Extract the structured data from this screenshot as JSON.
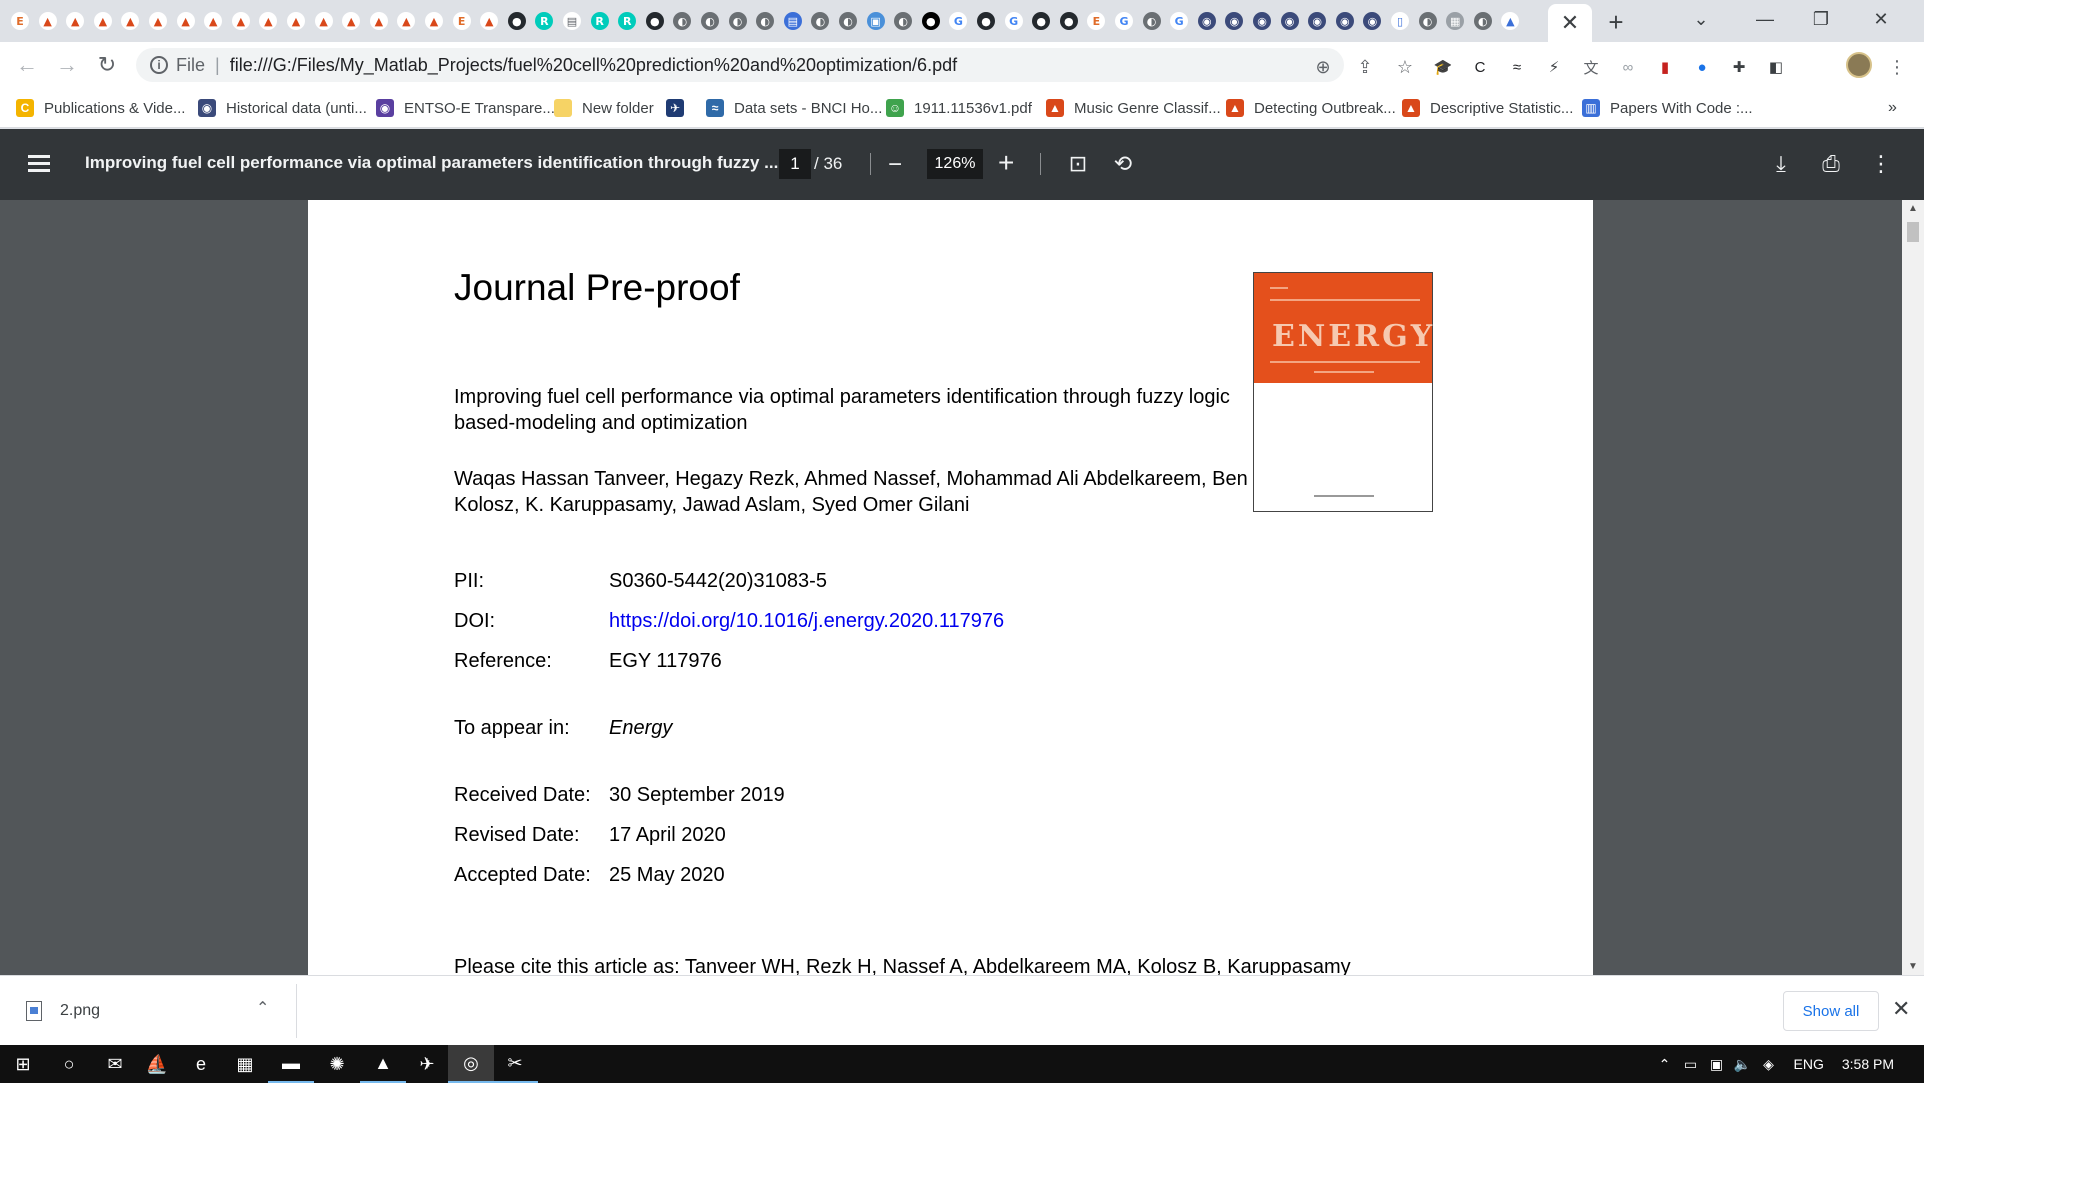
{
  "browser": {
    "mini_tabs": [
      {
        "icon": "ieee-e-icon",
        "glyph": "E",
        "bg": "#ffffff",
        "fg": "#e06c2a"
      },
      {
        "icon": "matlab-icon",
        "glyph": "▲",
        "bg": "#ffffff",
        "fg": "#d9481a"
      },
      {
        "icon": "matlab-icon",
        "glyph": "▲",
        "bg": "#ffffff",
        "fg": "#d9481a"
      },
      {
        "icon": "matlab-icon",
        "glyph": "▲",
        "bg": "#ffffff",
        "fg": "#d9481a"
      },
      {
        "icon": "matlab-icon",
        "glyph": "▲",
        "bg": "#ffffff",
        "fg": "#d9481a"
      },
      {
        "icon": "matlab-icon",
        "glyph": "▲",
        "bg": "#ffffff",
        "fg": "#d9481a"
      },
      {
        "icon": "matlab-icon",
        "glyph": "▲",
        "bg": "#ffffff",
        "fg": "#d9481a"
      },
      {
        "icon": "matlab-icon",
        "glyph": "▲",
        "bg": "#ffffff",
        "fg": "#d9481a"
      },
      {
        "icon": "matlab-icon",
        "glyph": "▲",
        "bg": "#ffffff",
        "fg": "#d9481a"
      },
      {
        "icon": "matlab-icon",
        "glyph": "▲",
        "bg": "#ffffff",
        "fg": "#d9481a"
      },
      {
        "icon": "matlab-icon",
        "glyph": "▲",
        "bg": "#ffffff",
        "fg": "#d9481a"
      },
      {
        "icon": "matlab-icon",
        "glyph": "▲",
        "bg": "#ffffff",
        "fg": "#d9481a"
      },
      {
        "icon": "matlab-icon",
        "glyph": "▲",
        "bg": "#ffffff",
        "fg": "#d9481a"
      },
      {
        "icon": "matlab-icon",
        "glyph": "▲",
        "bg": "#ffffff",
        "fg": "#d9481a"
      },
      {
        "icon": "matlab-icon",
        "glyph": "▲",
        "bg": "#ffffff",
        "fg": "#d9481a"
      },
      {
        "icon": "matlab-icon",
        "glyph": "▲",
        "bg": "#ffffff",
        "fg": "#d9481a"
      },
      {
        "icon": "ieee-e-icon",
        "glyph": "E",
        "bg": "#ffffff",
        "fg": "#e06c2a"
      },
      {
        "icon": "matlab-icon",
        "glyph": "▲",
        "bg": "#ffffff",
        "fg": "#d9481a"
      },
      {
        "icon": "github-icon",
        "glyph": "●",
        "bg": "#24292e",
        "fg": "#ffffff"
      },
      {
        "icon": "researchgate-icon",
        "glyph": "R",
        "bg": "#00ccbb",
        "fg": "#ffffff"
      },
      {
        "icon": "pdf-icon",
        "glyph": "▤",
        "bg": "#ffffff",
        "fg": "#5f6368"
      },
      {
        "icon": "researchgate-icon",
        "glyph": "R",
        "bg": "#00ccbb",
        "fg": "#ffffff"
      },
      {
        "icon": "researchgate-icon",
        "glyph": "R",
        "bg": "#00ccbb",
        "fg": "#ffffff"
      },
      {
        "icon": "github-icon",
        "glyph": "●",
        "bg": "#24292e",
        "fg": "#ffffff"
      },
      {
        "icon": "globe-icon",
        "glyph": "◐",
        "bg": "#6a6f73",
        "fg": "#ffffff"
      },
      {
        "icon": "globe-icon",
        "glyph": "◐",
        "bg": "#6a6f73",
        "fg": "#ffffff"
      },
      {
        "icon": "globe-icon",
        "glyph": "◐",
        "bg": "#6a6f73",
        "fg": "#ffffff"
      },
      {
        "icon": "globe-icon",
        "glyph": "◐",
        "bg": "#6a6f73",
        "fg": "#ffffff"
      },
      {
        "icon": "pdf-icon",
        "glyph": "▤",
        "bg": "#3b6fd8",
        "fg": "#ffffff"
      },
      {
        "icon": "globe-icon",
        "glyph": "◐",
        "bg": "#6a6f73",
        "fg": "#ffffff"
      },
      {
        "icon": "globe-icon",
        "glyph": "◐",
        "bg": "#6a6f73",
        "fg": "#ffffff"
      },
      {
        "icon": "image-icon",
        "glyph": "▣",
        "bg": "#4a90d9",
        "fg": "#ffffff"
      },
      {
        "icon": "globe-icon",
        "glyph": "◐",
        "bg": "#6a6f73",
        "fg": "#ffffff"
      },
      {
        "icon": "medium-icon",
        "glyph": "●",
        "bg": "#000000",
        "fg": "#ffffff"
      },
      {
        "icon": "google-icon",
        "glyph": "G",
        "bg": "#ffffff",
        "fg": "#4285f4"
      },
      {
        "icon": "github-icon",
        "glyph": "●",
        "bg": "#24292e",
        "fg": "#ffffff"
      },
      {
        "icon": "google-icon",
        "glyph": "G",
        "bg": "#ffffff",
        "fg": "#4285f4"
      },
      {
        "icon": "github-icon",
        "glyph": "●",
        "bg": "#24292e",
        "fg": "#ffffff"
      },
      {
        "icon": "github-icon",
        "glyph": "●",
        "bg": "#24292e",
        "fg": "#ffffff"
      },
      {
        "icon": "ieee-e-icon",
        "glyph": "E",
        "bg": "#ffffff",
        "fg": "#e06c2a"
      },
      {
        "icon": "google-icon",
        "glyph": "G",
        "bg": "#ffffff",
        "fg": "#4285f4"
      },
      {
        "icon": "globe-icon",
        "glyph": "◐",
        "bg": "#6a6f73",
        "fg": "#ffffff"
      },
      {
        "icon": "google-icon",
        "glyph": "G",
        "bg": "#ffffff",
        "fg": "#4285f4"
      },
      {
        "icon": "globe-icon",
        "glyph": "◉",
        "bg": "#3b4a7a",
        "fg": "#ffffff"
      },
      {
        "icon": "globe-icon",
        "glyph": "◉",
        "bg": "#3b4a7a",
        "fg": "#ffffff"
      },
      {
        "icon": "globe-icon",
        "glyph": "◉",
        "bg": "#3b4a7a",
        "fg": "#ffffff"
      },
      {
        "icon": "globe-icon",
        "glyph": "◉",
        "bg": "#3b4a7a",
        "fg": "#ffffff"
      },
      {
        "icon": "globe-icon",
        "glyph": "◉",
        "bg": "#3b4a7a",
        "fg": "#ffffff"
      },
      {
        "icon": "globe-icon",
        "glyph": "◉",
        "bg": "#3b4a7a",
        "fg": "#ffffff"
      },
      {
        "icon": "globe-icon",
        "glyph": "◉",
        "bg": "#3b4a7a",
        "fg": "#ffffff"
      },
      {
        "icon": "doc-icon",
        "glyph": "▯",
        "bg": "#ffffff",
        "fg": "#3b6fd8"
      },
      {
        "icon": "globe-icon",
        "glyph": "◐",
        "bg": "#6a6f73",
        "fg": "#ffffff"
      },
      {
        "icon": "image-icon",
        "glyph": "▦",
        "bg": "#9aa0a6",
        "fg": "#ffffff"
      },
      {
        "icon": "globe-icon",
        "glyph": "◐",
        "bg": "#6a6f73",
        "fg": "#ffffff"
      },
      {
        "icon": "matlab-icon",
        "glyph": "▲",
        "bg": "#ffffff",
        "fg": "#3b6fd8"
      }
    ],
    "active_tab_close": "✕",
    "new_tab": "+",
    "window_buttons": {
      "tab_search": "⌄",
      "minimize": "—",
      "restore": "❐",
      "close": "✕"
    },
    "nav": {
      "back": "←",
      "forward": "→",
      "reload": "↻"
    },
    "address": {
      "info_glyph": "i",
      "scheme_label": "File",
      "separator": "|",
      "url": "file:///G:/Files/My_Matlab_Projects/fuel%20cell%20prediction%20and%20optimization/6.pdf"
    },
    "omni_icons": {
      "zoom": "⊕",
      "share": "⇪",
      "star": "☆"
    },
    "extensions": [
      {
        "icon": "graduation-cap-icon",
        "glyph": "🎓",
        "color": "#1a73e8"
      },
      {
        "icon": "extension-c-icon",
        "glyph": "C",
        "color": "#202124"
      },
      {
        "icon": "extension-wave-icon",
        "glyph": "≈",
        "color": "#202124"
      },
      {
        "icon": "lightning-icon",
        "glyph": "⚡",
        "color": "#3c4043"
      },
      {
        "icon": "translate-icon",
        "glyph": "文",
        "color": "#5f6368"
      },
      {
        "icon": "link-icon",
        "glyph": "∞",
        "color": "#9aa0a6"
      },
      {
        "icon": "extension-red-icon",
        "glyph": "▮",
        "color": "#c5221f"
      },
      {
        "icon": "sphere-icon",
        "glyph": "●",
        "color": "#1a73e8"
      },
      {
        "icon": "puzzle-icon",
        "glyph": "✚",
        "color": "#3c4043"
      },
      {
        "icon": "sidepanel-icon",
        "glyph": "◧",
        "color": "#3c4043"
      }
    ],
    "menu_glyph": "⋮",
    "bookmarks": [
      {
        "label": "Publications & Vide...",
        "icon": "bookmark-c-icon",
        "glyph": "C",
        "bg": "#f4b400"
      },
      {
        "label": "Historical data (unti...",
        "icon": "bookmark-globe-icon",
        "glyph": "◉",
        "bg": "#3b4a7a"
      },
      {
        "label": "ENTSO-E Transpare...",
        "icon": "bookmark-entsoe-icon",
        "glyph": "◉",
        "bg": "#5a3fa0"
      },
      {
        "label": "New folder",
        "icon": "folder-icon",
        "glyph": "",
        "bg": "#f6d365"
      },
      {
        "label": "",
        "icon": "bookmark-bird-icon",
        "glyph": "✈",
        "bg": "#1f3b73"
      },
      {
        "label": "Data sets - BNCI Ho...",
        "icon": "bookmark-bnci-icon",
        "glyph": "≈",
        "bg": "#2f6aa8"
      },
      {
        "label": "1911.11536v1.pdf",
        "icon": "bookmark-smiley-icon",
        "glyph": "☺",
        "bg": "#3fa34d"
      },
      {
        "label": "Music Genre Classif...",
        "icon": "matlab-icon",
        "glyph": "▲",
        "bg": "#d9481a"
      },
      {
        "label": "Detecting Outbreak...",
        "icon": "matlab-icon",
        "glyph": "▲",
        "bg": "#d9481a"
      },
      {
        "label": "Descriptive Statistic...",
        "icon": "matlab-icon",
        "glyph": "▲",
        "bg": "#d9481a"
      },
      {
        "label": "Papers With Code :...",
        "icon": "paperswithcode-icon",
        "glyph": "▥",
        "bg": "#3b6fd8"
      }
    ],
    "bookmarks_more": "»"
  },
  "pdf": {
    "title": "Improving fuel cell performance via optimal parameters identification through fuzzy ...",
    "page_current": "1",
    "page_total": "/ 36",
    "zoom_out": "−",
    "zoom": "126%",
    "zoom_in": "+",
    "fit_glyph": "⊡",
    "rotate_glyph": "⟲",
    "download_glyph": "⤓",
    "print_glyph": "⎙",
    "more_glyph": "⋮",
    "scroll_up": "▲",
    "scroll_down": "▼"
  },
  "document": {
    "journal_label": "Journal Pre-proof",
    "title": "Improving fuel cell performance via optimal parameters identification through fuzzy logic based-modeling and optimization",
    "authors": "Waqas Hassan Tanveer, Hegazy Rezk, Ahmed Nassef, Mohammad Ali Abdelkareem, Ben Kolosz, K. Karuppasamy, Jawad Aslam, Syed Omer Gilani",
    "pii_label": "PII:",
    "pii_value": "S0360-5442(20)31083-5",
    "doi_label": "DOI:",
    "doi_value": "https://doi.org/10.1016/j.energy.2020.117976",
    "reference_label": "Reference:",
    "reference_value": "EGY 117976",
    "appear_label": "To appear in:",
    "appear_value": "Energy",
    "received_label": "Received Date:",
    "received_value": "30 September 2019",
    "revised_label": "Revised Date:",
    "revised_value": "17 April 2020",
    "accepted_label": "Accepted Date:",
    "accepted_value": "25 May 2020",
    "cite": "Please cite this article as: Tanveer WH, Rezk H, Nassef A, Abdelkareem MA, Kolosz B, Karuppasamy",
    "cover_word": "ENERGY",
    "cover_color": "#e4501c"
  },
  "downloads": {
    "file_name": "2.png",
    "chevron": "⌃",
    "show_all": "Show all",
    "close": "✕"
  },
  "taskbar": {
    "apps": [
      {
        "icon": "windows-start-icon",
        "glyph": "⊞",
        "running": false,
        "active": false
      },
      {
        "icon": "cortana-search-icon",
        "glyph": "○",
        "running": false,
        "active": false
      },
      {
        "icon": "mail-icon",
        "glyph": "✉",
        "running": false,
        "active": false
      },
      {
        "icon": "ship-icon",
        "glyph": "⛵",
        "running": false,
        "active": false
      },
      {
        "icon": "edge-icon",
        "glyph": "e",
        "running": false,
        "active": false
      },
      {
        "icon": "image-viewer-icon",
        "glyph": "▦",
        "running": false,
        "active": false
      },
      {
        "icon": "file-explorer-icon",
        "glyph": "▬",
        "running": true,
        "active": false
      },
      {
        "icon": "gear-app-icon",
        "glyph": "✺",
        "running": false,
        "active": false
      },
      {
        "icon": "matlab-icon",
        "glyph": "▲",
        "running": true,
        "active": false
      },
      {
        "icon": "telegram-icon",
        "glyph": "✈",
        "running": false,
        "active": false
      },
      {
        "icon": "chrome-icon",
        "glyph": "◎",
        "running": true,
        "active": true
      },
      {
        "icon": "snipping-tool-icon",
        "glyph": "✂",
        "running": true,
        "active": false
      }
    ],
    "tray": {
      "chevron": "⌃",
      "battery": "▭",
      "network": "▣",
      "volume": "🔈",
      "dropbox": "◈",
      "language": "ENG",
      "time": "3:58 PM"
    }
  }
}
